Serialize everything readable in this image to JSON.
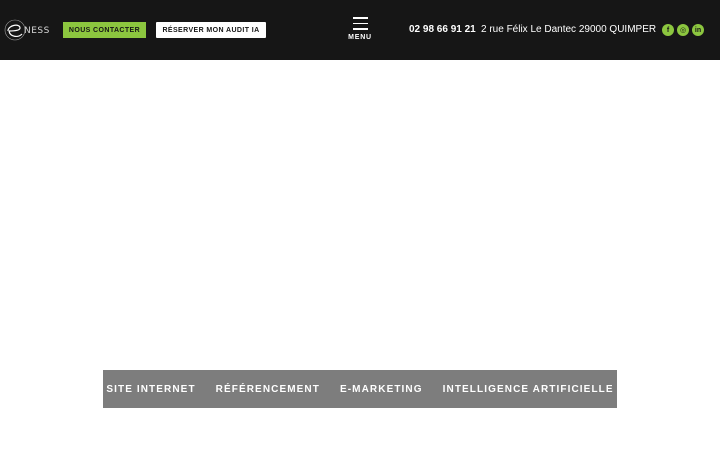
{
  "header": {
    "logo_text": "NESS",
    "contact_label": "NOUS CONTACTER",
    "audit_label": "RÉSERVER MON AUDIT IA",
    "menu_label": "MENU",
    "phone": "02 98 66 91 21",
    "address": "2 rue Félix Le Dantec 29000 QUIMPER",
    "socials": [
      {
        "icon": "facebook-icon",
        "glyph": "f"
      },
      {
        "icon": "instagram-icon",
        "glyph": "◎"
      },
      {
        "icon": "linkedin-icon",
        "glyph": "in"
      }
    ]
  },
  "nav": {
    "items": [
      {
        "label": "SITE INTERNET"
      },
      {
        "label": "RÉFÉRENCEMENT"
      },
      {
        "label": "E-MARKETING"
      },
      {
        "label": "INTELLIGENCE ARTIFICIELLE"
      }
    ]
  },
  "colors": {
    "header_bg": "#161616",
    "accent": "#8cc63f",
    "nav_bg": "#7d7d7d"
  }
}
